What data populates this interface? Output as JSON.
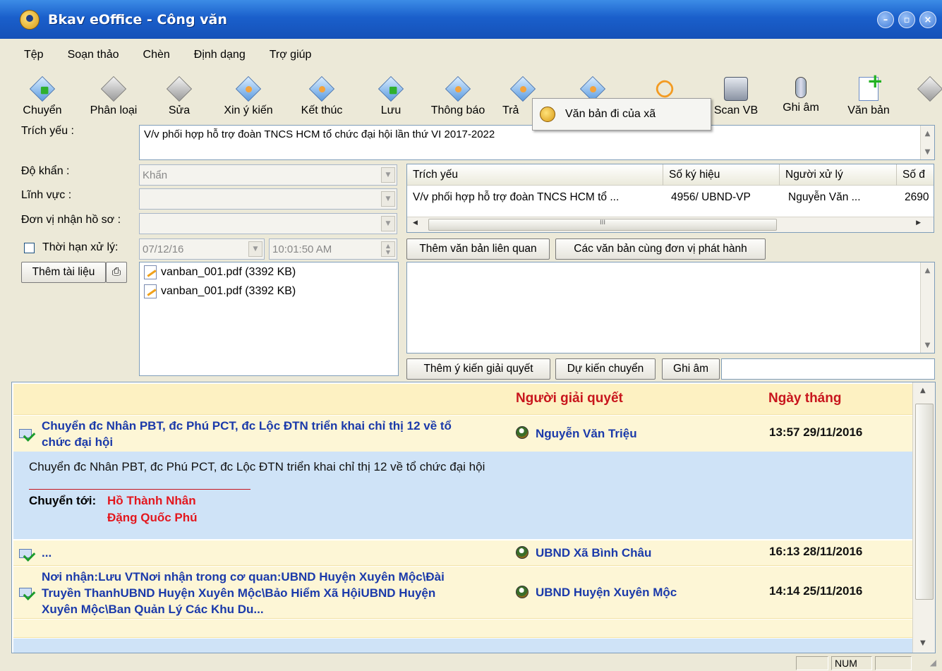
{
  "window": {
    "title": "Bkav eOffice - Công văn"
  },
  "menu": [
    "Tệp",
    "Soạn thảo",
    "Chèn",
    "Định dạng",
    "Trợ giúp"
  ],
  "toolbar": [
    {
      "label": "Chuyển",
      "icon": "forward-doc-icon"
    },
    {
      "label": "Phân loại",
      "icon": "classify-icon"
    },
    {
      "label": "Sửa",
      "icon": "edit-icon"
    },
    {
      "label": "Xin ý kiến",
      "icon": "ask-opinion-icon"
    },
    {
      "label": "Kết thúc",
      "icon": "lock-icon"
    },
    {
      "label": "Lưu",
      "icon": "save-icon"
    },
    {
      "label": "Thông báo",
      "icon": "notify-icon"
    },
    {
      "label": "Trả",
      "icon": "return-icon"
    },
    {
      "label": "",
      "icon": "person-doc-icon"
    },
    {
      "label": "",
      "icon": "paperclip-icon"
    },
    {
      "label": "Scan VB",
      "icon": "scanner-icon"
    },
    {
      "label": "Ghi âm",
      "icon": "microphone-icon"
    },
    {
      "label": "Văn bản",
      "icon": "new-document-icon"
    }
  ],
  "popup": {
    "item": "Văn bản đi của xã"
  },
  "form": {
    "trich_yeu_label": "Trích yếu :",
    "trich_yeu_value": "V/v phối hợp hỗ trợ đoàn TNCS HCM tổ chức đại hội lần thứ VI 2017-2022",
    "do_khan_label": "Độ khẩn :",
    "do_khan_value": "Khẩn",
    "linh_vuc_label": "Lĩnh vực :",
    "don_vi_label": "Đơn vị nhận hồ sơ :",
    "thoi_han_label": "Thời hạn xử lý:",
    "date_value": "07/12/16",
    "time_value": "10:01:50 AM",
    "add_doc_button": "Thêm tài liệu"
  },
  "attachments": [
    "vanban_001.pdf (3392 KB)",
    "vanban_001.pdf (3392 KB)"
  ],
  "grid": {
    "headers": [
      "Trích yếu",
      "Số ký hiệu",
      "Người xử lý",
      "Số đ"
    ],
    "rows": [
      [
        "V/v phối hợp hỗ trợ đoàn TNCS HCM tổ ...",
        "4956/ UBND-VP",
        "Nguyễn Văn ...",
        "2690"
      ]
    ],
    "scroll_label": "III"
  },
  "buttons": {
    "add_related": "Thêm văn bản liên quan",
    "same_issuer": "Các văn bản cùng đơn vị phát hành",
    "add_opinion": "Thêm ý kiến giải quyết",
    "plan_forward": "Dự kiến chuyển",
    "record": "Ghi âm"
  },
  "history": {
    "headers": {
      "person": "Người giải quyết",
      "date": "Ngày tháng"
    },
    "rows": [
      {
        "text": "Chuyển đc Nhân PBT, đc Phú PCT, đc Lộc ĐTN triển khai chỉ thị 12 về tổ chức đại hội",
        "line1": "Chuyển đc Nhân PBT, đc Phú PCT, đc Lộc ĐTN triển khai chỉ thị 12 về tổ",
        "line2": "chức đại hội",
        "person": "Nguyễn Văn Triệu",
        "date": "13:57 29/11/2016"
      },
      {
        "text": "...",
        "person": "UBND Xã Bình Châu",
        "date": "16:13 28/11/2016"
      },
      {
        "line1": "Nơi nhận:Lưu VTNơi nhận trong cơ quan:UBND Huyện Xuyên Mộc\\Đài",
        "line2": "Truyền ThanhUBND Huyện Xuyên Mộc\\Bảo Hiểm Xã HộiUBND Huyện",
        "line3": "Xuyên Mộc\\Ban Quản Lý Các Khu Du...",
        "person": "UBND Huyện Xuyên Mộc",
        "date": "14:14 25/11/2016"
      }
    ],
    "detail": {
      "message": "Chuyển đc Nhân PBT, đc Phú PCT, đc Lộc ĐTN triển khai chỉ thị 12 về tổ chức đại hội",
      "to_label": "Chuyển tới:",
      "to_names": [
        "Hồ Thành Nhân",
        "Đặng Quốc Phú"
      ]
    }
  },
  "status": {
    "num": "NUM"
  }
}
